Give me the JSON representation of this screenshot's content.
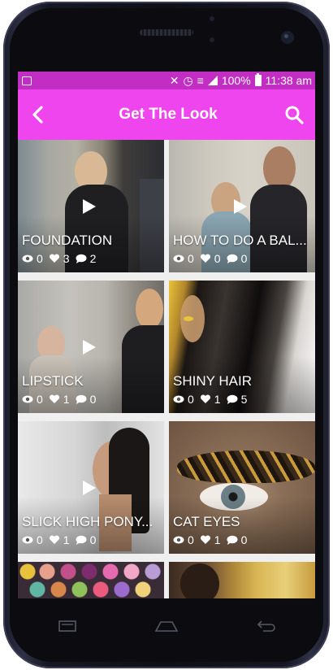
{
  "status_bar": {
    "battery": "100%",
    "time": "11:38 am"
  },
  "app_bar": {
    "title": "Get The Look"
  },
  "tiles": [
    {
      "title": "FOUNDATION",
      "views": "0",
      "likes": "3",
      "comments": "2",
      "video": true
    },
    {
      "title": "HOW TO DO A BAL...",
      "views": "0",
      "likes": "0",
      "comments": "0",
      "video": true
    },
    {
      "title": "LIPSTICK",
      "views": "0",
      "likes": "1",
      "comments": "0",
      "video": true
    },
    {
      "title": "SHINY HAIR",
      "views": "0",
      "likes": "1",
      "comments": "5",
      "video": false
    },
    {
      "title": "SLICK HIGH PONY...",
      "views": "0",
      "likes": "1",
      "comments": "0",
      "video": true
    },
    {
      "title": "CAT EYES",
      "views": "0",
      "likes": "1",
      "comments": "0",
      "video": false
    }
  ],
  "colors": {
    "status_bar": "#c22ec4",
    "app_bar": "#ef45ee"
  }
}
